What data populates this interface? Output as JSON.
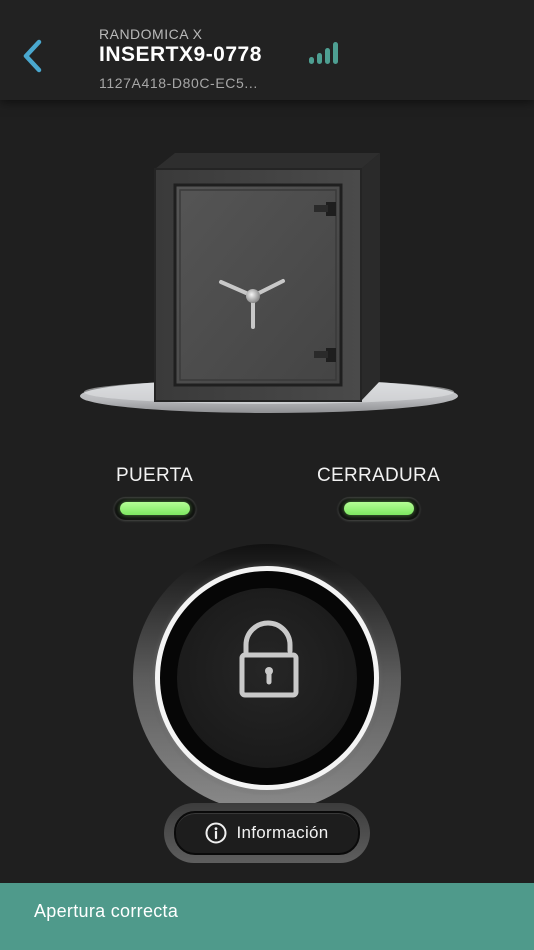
{
  "header": {
    "brand": "RANDOMICA X",
    "title": "INSERTX9-0778",
    "device_id": "1127A418-D80C-EC5...",
    "back_icon": "chevron-left-icon",
    "signal_icon": "signal-bars-icon",
    "signal_level": 4,
    "accent_color": "#4aa8cf",
    "signal_color": "#4e9f92"
  },
  "status": {
    "door": {
      "label": "PUERTA",
      "state": "ok",
      "color": "#8cf06e"
    },
    "lock": {
      "label": "CERRADURA",
      "state": "ok",
      "color": "#8cf06e"
    }
  },
  "lock_button": {
    "icon": "padlock-open-icon"
  },
  "info_button": {
    "label": "Información",
    "icon": "info-circle-icon"
  },
  "toast": {
    "message": "Apertura correcta",
    "color": "#4f9a8b"
  }
}
